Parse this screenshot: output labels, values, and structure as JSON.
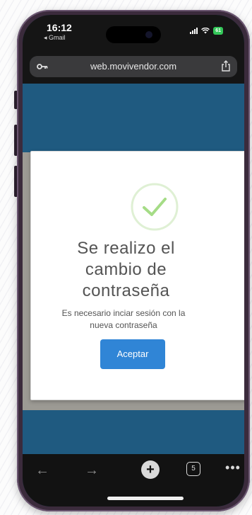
{
  "status_bar": {
    "time": "16:12",
    "back_app": "◂ Gmail",
    "battery": "61"
  },
  "browser": {
    "url": "web.movivendor.com"
  },
  "modal": {
    "title_line1": "Se realizo el",
    "title_line2": "cambio de",
    "title_line3": "contraseña",
    "message_line1": "Es necesario inciar sesión con la",
    "message_line2": "nueva contraseña",
    "accept_label": "Aceptar"
  },
  "toolbar": {
    "back_icon": "←",
    "forward_icon": "→",
    "plus_icon": "+",
    "tabs_count": "5",
    "more_icon": "•••"
  },
  "colors": {
    "accent": "#3085d6",
    "page_bg": "#1f5a80",
    "success": "#a5dc86"
  }
}
